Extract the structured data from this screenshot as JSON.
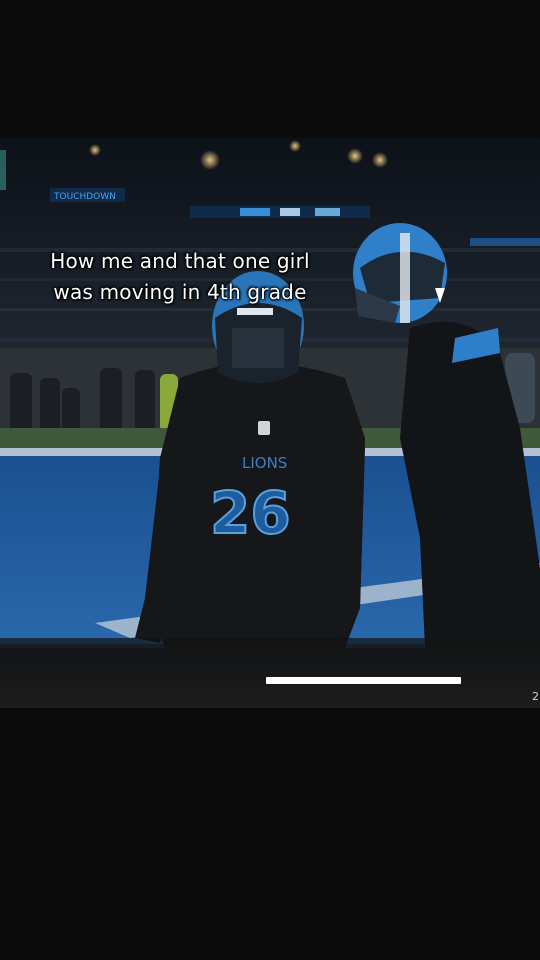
{
  "caption": {
    "line1": "How me and that one girl",
    "line2": "was moving in 4th grade"
  },
  "scene": {
    "description_icon": "football-players-icon",
    "stadium_signs": [
      "TOUCHDOWN"
    ],
    "jersey_number": "26",
    "jersey_text": "LIONS"
  },
  "video": {
    "progress_fraction": 0.855
  },
  "colors": {
    "background": "#0b0b0b",
    "field_blue": "#1f5aa0",
    "helmet_blue": "#3b8fd6",
    "caption_text": "#ffffff",
    "progress_fill": "#ffffff"
  }
}
